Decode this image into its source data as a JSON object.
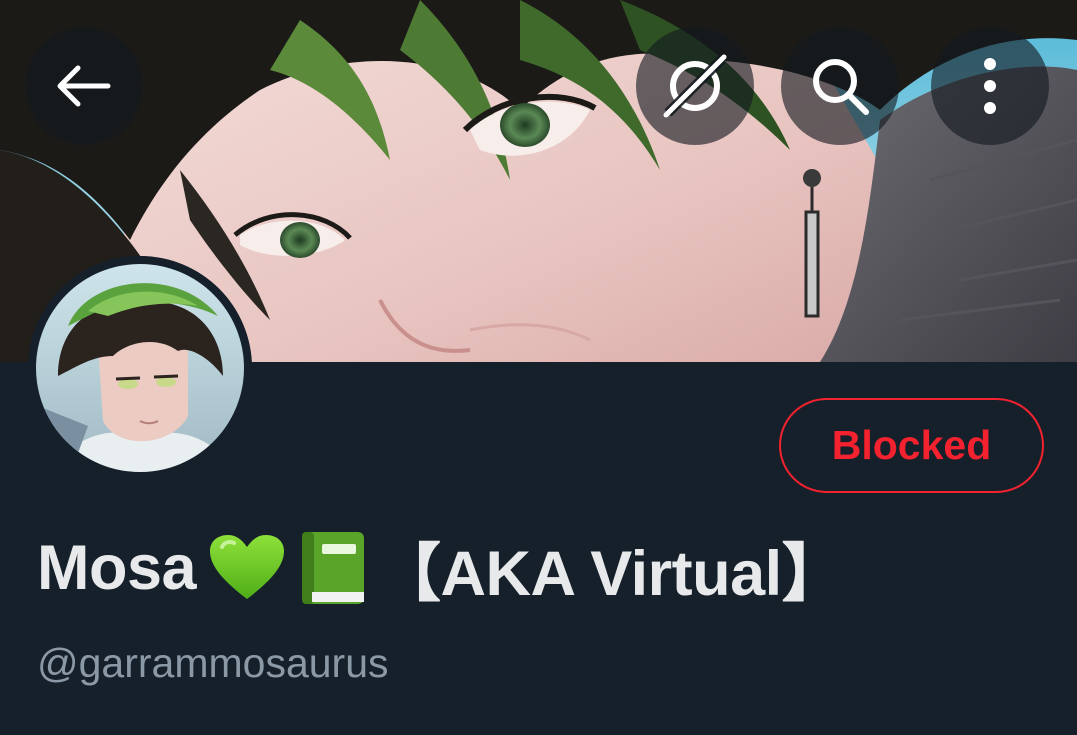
{
  "header": {
    "back_icon": "arrow-left-icon",
    "grok_icon": "grok-icon",
    "search_icon": "search-icon",
    "more_icon": "more-vertical-icon"
  },
  "profile": {
    "display_name": "Mosa",
    "name_emojis": [
      "green-heart-icon",
      "green-book-icon"
    ],
    "name_suffix": "【AKA Virtual】",
    "handle": "@garrammosaurus",
    "block_status_label": "Blocked"
  },
  "colors": {
    "background": "#15202b",
    "blocked_accent": "#f4212e",
    "primary_text": "#e7e9ea",
    "secondary_text": "#8b98a5"
  }
}
